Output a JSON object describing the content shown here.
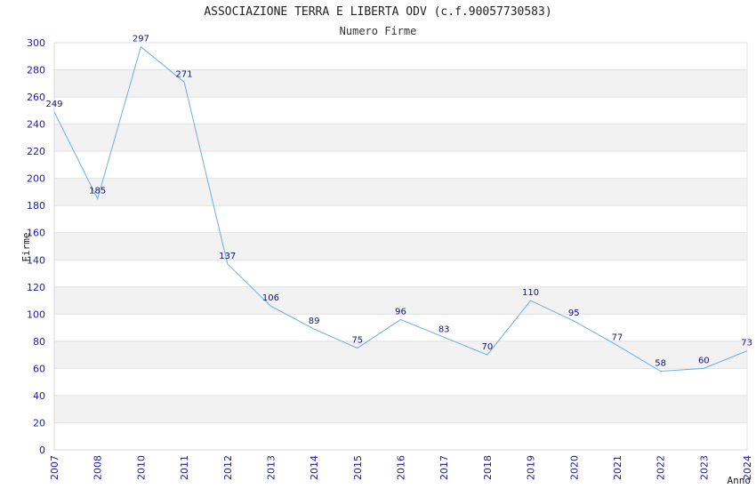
{
  "chart_data": {
    "type": "line",
    "title": "ASSOCIAZIONE TERRA E LIBERTA ODV (c.f.90057730583)",
    "subtitle": "Numero Firme",
    "xlabel": "Anno",
    "ylabel": "Firme",
    "categories": [
      "2007",
      "2008",
      "2010",
      "2011",
      "2012",
      "2013",
      "2014",
      "2015",
      "2016",
      "2017",
      "2018",
      "2019",
      "2020",
      "2021",
      "2022",
      "2023",
      "2024"
    ],
    "series": [
      {
        "values": [
          249,
          185,
          297,
          271,
          137,
          106,
          89,
          75,
          96,
          83,
          70,
          110,
          95,
          77,
          58,
          60,
          73
        ]
      }
    ],
    "ylim": [
      0,
      300
    ],
    "yticks": [
      0,
      20,
      40,
      60,
      80,
      100,
      120,
      140,
      160,
      180,
      200,
      220,
      240,
      260,
      280,
      300
    ],
    "grid": true,
    "line_color": "#6aaee8",
    "band_color": "#f2f2f2",
    "tick_color": "#1a1aa8",
    "label_color": "#10107a"
  }
}
